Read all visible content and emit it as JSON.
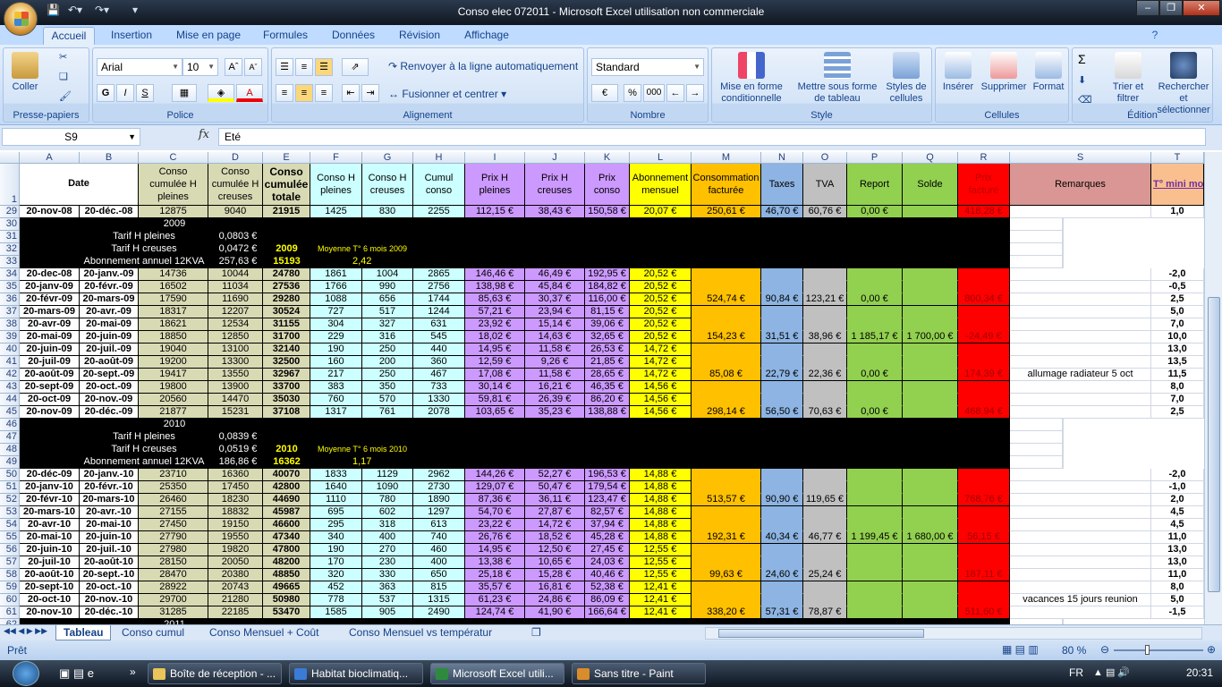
{
  "window": {
    "title": "Conso elec 072011 - Microsoft Excel utilisation non commerciale"
  },
  "ribbon": {
    "tabs": [
      "Accueil",
      "Insertion",
      "Mise en page",
      "Formules",
      "Données",
      "Révision",
      "Affichage"
    ],
    "clipboard": {
      "paste": "Coller",
      "label": "Presse-papiers"
    },
    "font": {
      "name": "Arial",
      "size": "10",
      "bold": "G",
      "italic": "I",
      "underline": "S",
      "label": "Police"
    },
    "alignment": {
      "wrap": "Renvoyer à la ligne automatiquement",
      "merge": "Fusionner et centrer",
      "label": "Alignement"
    },
    "number": {
      "format": "Standard",
      "percent": "%",
      "thousands": "000",
      "label": "Nombre"
    },
    "style": {
      "conditional": "Mise en forme conditionnelle",
      "table": "Mettre sous forme de tableau",
      "cellstyles": "Styles de cellules",
      "label": "Style"
    },
    "cells": {
      "insert": "Insérer",
      "delete": "Supprimer",
      "format": "Format",
      "label": "Cellules"
    },
    "editing": {
      "sort": "Trier et filtrer",
      "find": "Rechercher et sélectionner",
      "sum": "Σ",
      "label": "Édition"
    }
  },
  "formula_bar": {
    "name_box": "S9",
    "fx": "fx",
    "value": "Eté"
  },
  "columns": [
    "A",
    "B",
    "C",
    "D",
    "E",
    "F",
    "G",
    "H",
    "I",
    "J",
    "K",
    "L",
    "M",
    "N",
    "O",
    "P",
    "Q",
    "R",
    "S",
    "T"
  ],
  "header_row": {
    "n": "1",
    "date": "Date",
    "cells": [
      "Conso cumulée H pleines",
      "Conso cumulée H creuses",
      "Conso cumulée totale",
      "Conso H pleines",
      "Conso H creuses",
      "Cumul conso",
      "Prix H pleines",
      "Prix H creuses",
      "Prix conso",
      "Abonnement mensuel",
      "Consommation facturée",
      "Taxes",
      "TVA",
      "Report",
      "Solde",
      "Prix facturé",
      "Remarques",
      "T° mini moy"
    ]
  },
  "rows": [
    {
      "n": "29",
      "end": true,
      "cells": [
        "20-nov-08",
        "20-déc.-08",
        "12875",
        "9040",
        "21915",
        "1425",
        "830",
        "2255",
        "112,15 €",
        "38,43 €",
        "150,58 €",
        "20,07 €",
        "250,61 €",
        "46,70 €",
        "60,76 €",
        "0,00 €",
        "",
        "418,28 €",
        "",
        "1,0"
      ]
    },
    {
      "n": "30",
      "black": {
        "year": "2009"
      }
    },
    {
      "n": "31",
      "black": {
        "label": "Tarif H pleines",
        "value": "0,0803 €"
      }
    },
    {
      "n": "32",
      "black": {
        "label": "Tarif H creuses",
        "value": "0,0472 €",
        "yellow": "2009",
        "note": "Moyenne T° 6 mois 2009"
      }
    },
    {
      "n": "33",
      "black": {
        "label": "Abonnement annuel 12KVA",
        "value": "257,63 €",
        "yellow": "15193",
        "note": "2,42"
      }
    },
    {
      "n": "34",
      "cells": [
        "20-dec-08",
        "20-janv.-09",
        "14736",
        "10044",
        "24780",
        "1861",
        "1004",
        "2865",
        "146,46 €",
        "46,49 €",
        "192,95 €",
        "20,52 €",
        "",
        "",
        "",
        "",
        "",
        "",
        "",
        "-2,0"
      ]
    },
    {
      "n": "35",
      "cells": [
        "20-janv-09",
        "20-févr.-09",
        "16502",
        "11034",
        "27536",
        "1766",
        "990",
        "2756",
        "138,98 €",
        "45,84 €",
        "184,82 €",
        "20,52 €",
        "",
        "",
        "",
        "",
        "",
        "",
        "",
        "-0,5"
      ]
    },
    {
      "n": "36",
      "end": true,
      "cells": [
        "20-févr-09",
        "20-mars-09",
        "17590",
        "11690",
        "29280",
        "1088",
        "656",
        "1744",
        "85,63 €",
        "30,37 €",
        "116,00 €",
        "20,52 €",
        "524,74 €",
        "90,84 €",
        "123,21 €",
        "0,00 €",
        "",
        "800,34 €",
        "",
        "2,5"
      ]
    },
    {
      "n": "37",
      "cells": [
        "20-mars-09",
        "20-avr.-09",
        "18317",
        "12207",
        "30524",
        "727",
        "517",
        "1244",
        "57,21 €",
        "23,94 €",
        "81,15 €",
        "20,52 €",
        "",
        "",
        "",
        "",
        "",
        "",
        "",
        "5,0"
      ]
    },
    {
      "n": "38",
      "cells": [
        "20-avr-09",
        "20-mai-09",
        "18621",
        "12534",
        "31155",
        "304",
        "327",
        "631",
        "23,92 €",
        "15,14 €",
        "39,06 €",
        "20,52 €",
        "",
        "",
        "",
        "",
        "",
        "",
        "",
        "7,0"
      ]
    },
    {
      "n": "39",
      "end": true,
      "cells": [
        "20-mai-09",
        "20-juin-09",
        "18850",
        "12850",
        "31700",
        "229",
        "316",
        "545",
        "18,02 €",
        "14,63 €",
        "32,65 €",
        "20,52 €",
        "154,23 €",
        "31,51 €",
        "38,96 €",
        "1 185,17 €",
        "1 700,00 €",
        "-24,49 €",
        "",
        "10,0"
      ]
    },
    {
      "n": "40",
      "cells": [
        "20-juin-09",
        "20-juil.-09",
        "19040",
        "13100",
        "32140",
        "190",
        "250",
        "440",
        "14,95 €",
        "11,58 €",
        "26,53 €",
        "14,72 €",
        "",
        "",
        "",
        "",
        "",
        "",
        "",
        "13,0"
      ]
    },
    {
      "n": "41",
      "cells": [
        "20-juil-09",
        "20-août-09",
        "19200",
        "13300",
        "32500",
        "160",
        "200",
        "360",
        "12,59 €",
        "9,26 €",
        "21,85 €",
        "14,72 €",
        "",
        "",
        "",
        "",
        "",
        "",
        "",
        "13,5"
      ]
    },
    {
      "n": "42",
      "end": true,
      "cells": [
        "20-août-09",
        "20-sept.-09",
        "19417",
        "13550",
        "32967",
        "217",
        "250",
        "467",
        "17,08 €",
        "11,58 €",
        "28,65 €",
        "14,72 €",
        "85,08 €",
        "22,79 €",
        "22,36 €",
        "0,00 €",
        "",
        "174,39 €",
        "allumage radiateur 5 oct",
        "11,5"
      ]
    },
    {
      "n": "43",
      "cells": [
        "20-sept-09",
        "20-oct.-09",
        "19800",
        "13900",
        "33700",
        "383",
        "350",
        "733",
        "30,14 €",
        "16,21 €",
        "46,35 €",
        "14,56 €",
        "",
        "",
        "",
        "",
        "",
        "",
        "",
        "8,0"
      ]
    },
    {
      "n": "44",
      "cells": [
        "20-oct-09",
        "20-nov.-09",
        "20560",
        "14470",
        "35030",
        "760",
        "570",
        "1330",
        "59,81 €",
        "26,39 €",
        "86,20 €",
        "14,56 €",
        "",
        "",
        "",
        "",
        "",
        "",
        "",
        "7,0"
      ]
    },
    {
      "n": "45",
      "end": true,
      "cells": [
        "20-nov-09",
        "20-déc.-09",
        "21877",
        "15231",
        "37108",
        "1317",
        "761",
        "2078",
        "103,65 €",
        "35,23 €",
        "138,88 €",
        "14,56 €",
        "298,14 €",
        "56,50 €",
        "70,63 €",
        "0,00 €",
        "",
        "468,94 €",
        "",
        "2,5"
      ]
    },
    {
      "n": "46",
      "black": {
        "year": "2010"
      }
    },
    {
      "n": "47",
      "black": {
        "label": "Tarif H pleines",
        "value": "0,0839 €"
      }
    },
    {
      "n": "48",
      "black": {
        "label": "Tarif H creuses",
        "value": "0,0519 €",
        "yellow": "2010",
        "note": "Moyenne T° 6 mois 2010"
      }
    },
    {
      "n": "49",
      "black": {
        "label": "Abonnement annuel 12KVA",
        "value": "186,86 €",
        "yellow": "16362",
        "note": "1,17"
      }
    },
    {
      "n": "50",
      "cells": [
        "20-déc-09",
        "20-janv.-10",
        "23710",
        "16360",
        "40070",
        "1833",
        "1129",
        "2962",
        "144,26 €",
        "52,27 €",
        "196,53 €",
        "14,88 €",
        "",
        "",
        "",
        "",
        "",
        "",
        "",
        "-2,0"
      ]
    },
    {
      "n": "51",
      "cells": [
        "20-janv-10",
        "20-févr.-10",
        "25350",
        "17450",
        "42800",
        "1640",
        "1090",
        "2730",
        "129,07 €",
        "50,47 €",
        "179,54 €",
        "14,88 €",
        "",
        "",
        "",
        "",
        "",
        "",
        "",
        "-1,0"
      ]
    },
    {
      "n": "52",
      "end": true,
      "cells": [
        "20-févr-10",
        "20-mars-10",
        "26460",
        "18230",
        "44690",
        "1110",
        "780",
        "1890",
        "87,36 €",
        "36,11 €",
        "123,47 €",
        "14,88 €",
        "513,57 €",
        "90,90 €",
        "119,65 €",
        "",
        "",
        "768,76 €",
        "",
        "2,0"
      ]
    },
    {
      "n": "53",
      "cells": [
        "20-mars-10",
        "20-avr.-10",
        "27155",
        "18832",
        "45987",
        "695",
        "602",
        "1297",
        "54,70 €",
        "27,87 €",
        "82,57 €",
        "14,88 €",
        "",
        "",
        "",
        "",
        "",
        "",
        "",
        "4,5"
      ]
    },
    {
      "n": "54",
      "cells": [
        "20-avr-10",
        "20-mai-10",
        "27450",
        "19150",
        "46600",
        "295",
        "318",
        "613",
        "23,22 €",
        "14,72 €",
        "37,94 €",
        "14,88 €",
        "",
        "",
        "",
        "",
        "",
        "",
        "",
        "4,5"
      ]
    },
    {
      "n": "55",
      "end": true,
      "cells": [
        "20-mai-10",
        "20-juin-10",
        "27790",
        "19550",
        "47340",
        "340",
        "400",
        "740",
        "26,76 €",
        "18,52 €",
        "45,28 €",
        "14,88 €",
        "192,31 €",
        "40,34 €",
        "46,77 €",
        "1 199,45 €",
        "1 680,00 €",
        "56,15 €",
        "",
        "11,0"
      ]
    },
    {
      "n": "56",
      "cells": [
        "20-juin-10",
        "20-juil.-10",
        "27980",
        "19820",
        "47800",
        "190",
        "270",
        "460",
        "14,95 €",
        "12,50 €",
        "27,45 €",
        "12,55 €",
        "",
        "",
        "",
        "",
        "",
        "",
        "",
        "13,0"
      ]
    },
    {
      "n": "57",
      "cells": [
        "20-juil-10",
        "20-août-10",
        "28150",
        "20050",
        "48200",
        "170",
        "230",
        "400",
        "13,38 €",
        "10,65 €",
        "24,03 €",
        "12,55 €",
        "",
        "",
        "",
        "",
        "",
        "",
        "",
        "13,0"
      ]
    },
    {
      "n": "58",
      "end": true,
      "cells": [
        "20-août-10",
        "20-sept.-10",
        "28470",
        "20380",
        "48850",
        "320",
        "330",
        "650",
        "25,18 €",
        "15,28 €",
        "40,46 €",
        "12,55 €",
        "99,63 €",
        "24,60 €",
        "25,24 €",
        "",
        "",
        "187,11 €",
        "",
        "11,0"
      ]
    },
    {
      "n": "59",
      "cells": [
        "20-sept-10",
        "20-oct.-10",
        "28922",
        "20743",
        "49665",
        "452",
        "363",
        "815",
        "35,57 €",
        "16,81 €",
        "52,38 €",
        "12,41 €",
        "",
        "",
        "",
        "",
        "",
        "",
        "",
        "8,0"
      ]
    },
    {
      "n": "60",
      "cells": [
        "20-oct-10",
        "20-nov.-10",
        "29700",
        "21280",
        "50980",
        "778",
        "537",
        "1315",
        "61,23 €",
        "24,86 €",
        "86,09 €",
        "12,41 €",
        "",
        "",
        "",
        "",
        "",
        "",
        "vacances 15 jours reunion",
        "5,0"
      ]
    },
    {
      "n": "61",
      "end": true,
      "cells": [
        "20-nov-10",
        "20-déc.-10",
        "31285",
        "22185",
        "53470",
        "1585",
        "905",
        "2490",
        "124,74 €",
        "41,90 €",
        "166,64 €",
        "12,41 €",
        "338,20 €",
        "57,31 €",
        "78,87 €",
        "",
        "",
        "511,60 €",
        "",
        "-1,5"
      ]
    },
    {
      "n": "62",
      "black": {
        "year": "2011"
      }
    }
  ],
  "col_colors": [
    "#ffffff",
    "#ffffff",
    "#d8dab4",
    "#d8dab4",
    "#d8dab4",
    "#ccffff",
    "#ccffff",
    "#ccffff",
    "#cc99ff",
    "#cc99ff",
    "#cc99ff",
    "#ffff00",
    "#ffc000",
    "#8db4e2",
    "#c0c0c0",
    "#92d050",
    "#92d050",
    "#ff0000",
    "#da9694",
    "#fabf8f"
  ],
  "sheet_tabs": [
    {
      "label": "Tableau",
      "active": true
    },
    {
      "label": "Conso cumul"
    },
    {
      "label": "Conso Mensuel + Coût"
    },
    {
      "label": "Conso Mensuel vs températur"
    }
  ],
  "status": {
    "ready": "Prêt",
    "zoom": "80 %"
  },
  "taskbar": {
    "items": [
      "Boîte de réception - ...",
      "Habitat bioclimatiq...",
      "Microsoft Excel utili...",
      "Sans titre - Paint"
    ],
    "lang": "FR",
    "time": "20:31"
  }
}
